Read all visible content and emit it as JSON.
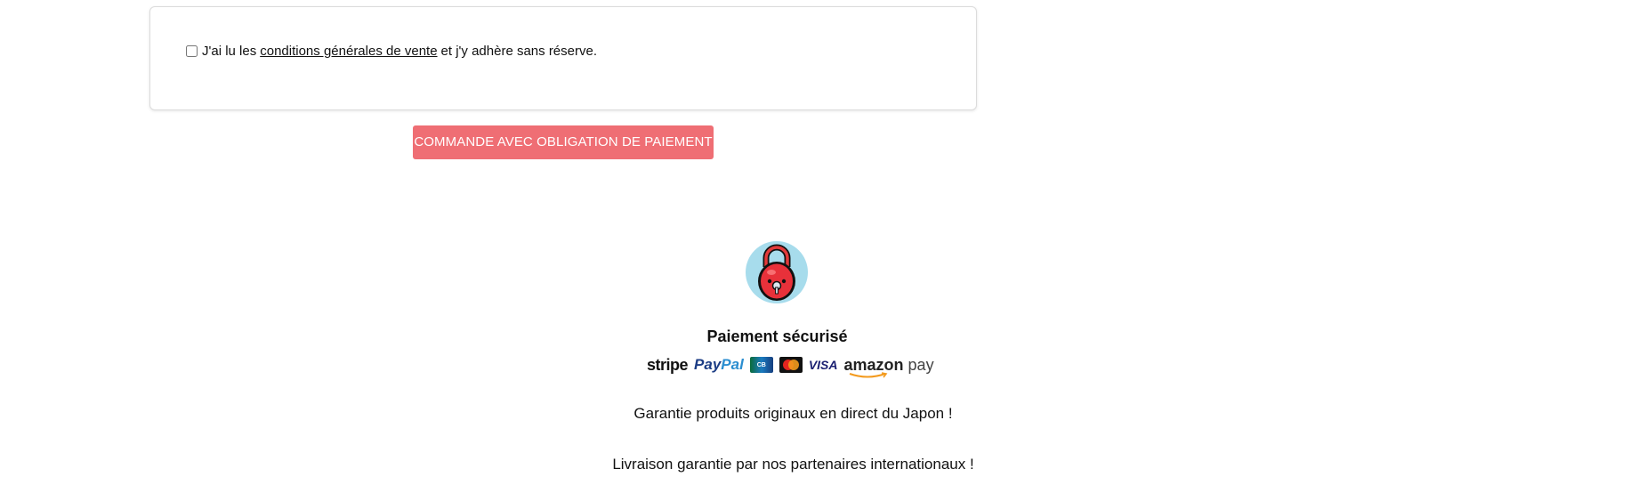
{
  "terms": {
    "prefix": "J'ai lu les",
    "link": "conditions générales de vente",
    "suffix": "et j'y adhère sans réserve."
  },
  "order_button": {
    "label": "COMMANDE AVEC OBLIGATION DE PAIEMENT",
    "color": "#ef6e74"
  },
  "secure": {
    "title": "Paiement sécurisé",
    "logos": {
      "stripe": "stripe",
      "paypal_a": "Pay",
      "paypal_b": "Pal",
      "cb": "CB",
      "mastercard": "MasterCard",
      "visa": "VISA",
      "amazon_a": "amazon",
      "amazon_b": "pay"
    }
  },
  "guarantees": {
    "line1": "Garantie produits originaux en direct du Japon !",
    "line2": "Livraison garantie par nos partenaires internationaux !"
  },
  "icons": {
    "logo": "red-padlock-mascot-icon"
  }
}
